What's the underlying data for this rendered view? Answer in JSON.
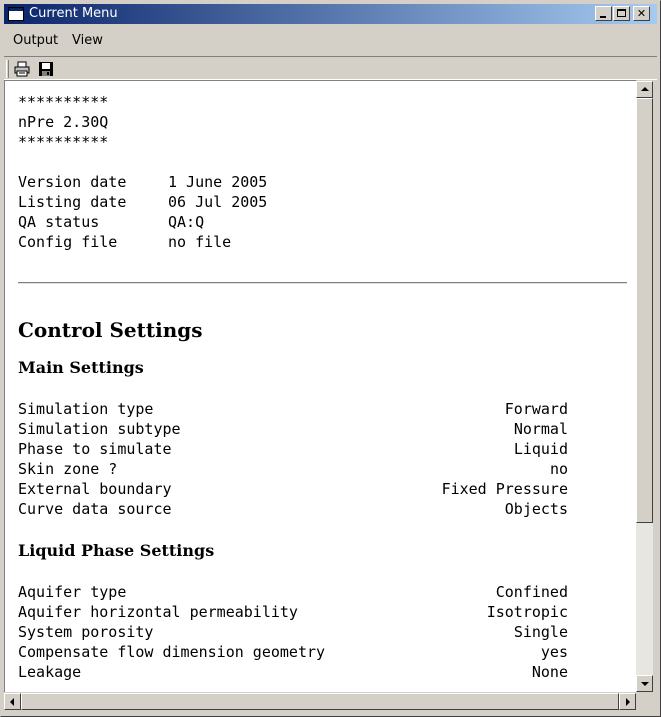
{
  "window": {
    "title": "Current Menu"
  },
  "menubar": {
    "items": [
      {
        "label": "Output"
      },
      {
        "label": "View"
      }
    ]
  },
  "header": {
    "stars_top": "**********",
    "program": "nPre 2.30Q",
    "stars_bottom": "**********"
  },
  "info": [
    {
      "key": "Version date",
      "value": "1 June 2005"
    },
    {
      "key": "Listing date",
      "value": "06 Jul 2005"
    },
    {
      "key": "QA status",
      "value": "QA:Q"
    },
    {
      "key": "Config file",
      "value": "no file"
    }
  ],
  "control_settings": {
    "heading": "Control Settings"
  },
  "main_settings": {
    "heading": "Main Settings",
    "rows": [
      {
        "key": "Simulation type",
        "value": "Forward"
      },
      {
        "key": "Simulation subtype",
        "value": "Normal"
      },
      {
        "key": "Phase to simulate",
        "value": "Liquid"
      },
      {
        "key": "Skin zone ?",
        "value": "no"
      },
      {
        "key": "External boundary",
        "value": "Fixed Pressure"
      },
      {
        "key": "Curve data source",
        "value": "Objects"
      }
    ]
  },
  "liquid_settings": {
    "heading": "Liquid Phase Settings",
    "rows": [
      {
        "key": "Aquifer type",
        "value": "Confined"
      },
      {
        "key": "Aquifer horizontal permeability",
        "value": "Isotropic"
      },
      {
        "key": "System porosity",
        "value": "Single"
      },
      {
        "key": "Compensate flow dimension geometry",
        "value": "yes"
      },
      {
        "key": "Leakage",
        "value": "None"
      }
    ]
  }
}
